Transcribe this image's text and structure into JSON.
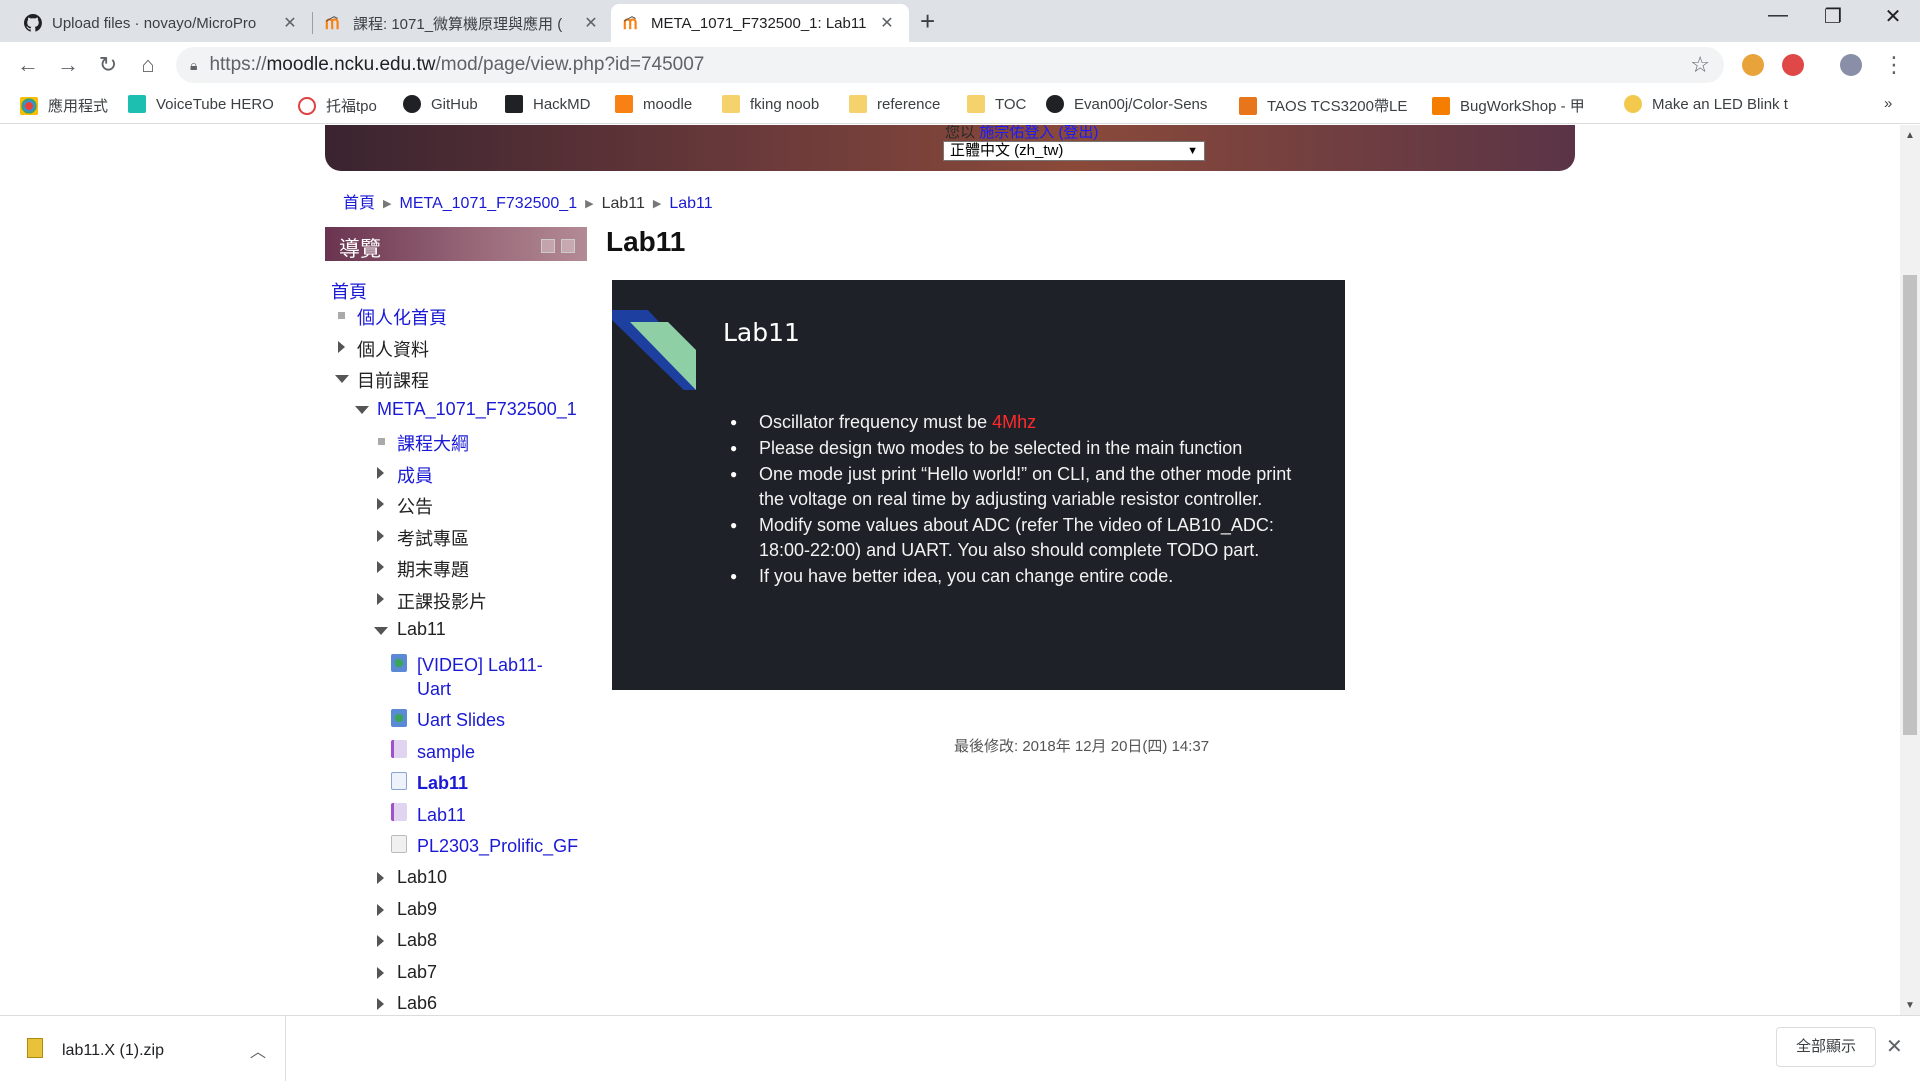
{
  "browser": {
    "tabs": [
      {
        "title": "Upload files · novayo/MicroPro",
        "icon": "github-icon"
      },
      {
        "title": "課程: 1071_微算機原理與應用 (",
        "icon": "moodle-icon"
      },
      {
        "title": "META_1071_F732500_1: Lab11",
        "icon": "moodle-icon"
      }
    ],
    "new_tab": "+",
    "controls": {
      "minimize": "—",
      "restore": "❐",
      "close": "✕"
    },
    "url_prefix": "https://",
    "url_host": "moodle.ncku.edu.tw",
    "url_path": "/mod/page/view.php?id=745007",
    "bookmarks": [
      {
        "label": "應用程式",
        "icon": "apps-grid-icon"
      },
      {
        "label": "VoiceTube HERO",
        "icon": "voicetube-icon"
      },
      {
        "label": "托福tpo",
        "icon": "tpo-icon"
      },
      {
        "label": "GitHub",
        "icon": "github-icon"
      },
      {
        "label": "HackMD",
        "icon": "hackmd-icon"
      },
      {
        "label": "moodle",
        "icon": "moodle-icon"
      },
      {
        "label": "fking noob",
        "icon": "folder-icon"
      },
      {
        "label": "reference",
        "icon": "folder-icon"
      },
      {
        "label": "TOC",
        "icon": "folder-icon"
      },
      {
        "label": "Evan00j/Color-Sens",
        "icon": "github-icon"
      },
      {
        "label": "TAOS TCS3200帶LE",
        "icon": "taos-icon"
      },
      {
        "label": "BugWorkShop - 甲",
        "icon": "blogger-icon"
      },
      {
        "label": "Make an LED Blink t",
        "icon": "led-icon"
      }
    ],
    "bookmarks_more": "»"
  },
  "page": {
    "header": {
      "login_prefix": "您以",
      "login_link": "施宗佑登入 (登出)",
      "language": "正體中文 (zh_tw)"
    },
    "breadcrumb": [
      "首頁",
      "META_1071_F732500_1",
      "Lab11",
      "Lab11"
    ],
    "nav_block": {
      "title": "導覽",
      "items": [
        {
          "label": "首頁"
        },
        {
          "label": "個人化首頁"
        },
        {
          "label": "個人資料"
        },
        {
          "label": "目前課程"
        },
        {
          "label": "META_1071_F732500_1"
        },
        {
          "label": "課程大綱"
        },
        {
          "label": "成員"
        },
        {
          "label": "公告"
        },
        {
          "label": "考試專區"
        },
        {
          "label": "期末專題"
        },
        {
          "label": "正課投影片"
        },
        {
          "label": "Lab11"
        },
        {
          "label": "[VIDEO] Lab11-"
        },
        {
          "label": "Uart"
        },
        {
          "label": "Uart Slides"
        },
        {
          "label": "sample"
        },
        {
          "label": "Lab11"
        },
        {
          "label": "Lab11"
        },
        {
          "label": "PL2303_Prolific_GF"
        },
        {
          "label": "Lab10"
        },
        {
          "label": "Lab9"
        },
        {
          "label": "Lab8"
        },
        {
          "label": "Lab7"
        },
        {
          "label": "Lab6"
        }
      ]
    },
    "main_title": "Lab11",
    "slide": {
      "title": "Lab11",
      "bullets": {
        "b1_pre": "Oscillator frequency must be ",
        "b1_red": "4Mhz",
        "b2": "Please design two modes to be selected in the main function",
        "b3": "One mode just print “Hello world!” on CLI, and the other mode print the voltage on real time by adjusting variable resistor controller.",
        "b4": "Modify some values about ADC (refer The video of LAB10_ADC: 18:00-22:00) and UART. You also should complete TODO part.",
        "b5": "If you have better idea, you can change entire code."
      },
      "accent_colors": {
        "blue": "#1c3fa0",
        "green": "#8ecfa6",
        "red": "#ff2b2b"
      }
    },
    "last_modified": "最後修改: 2018年 12月 20日(四) 14:37"
  },
  "downloads": {
    "file_name": "lab11.X (1).zip",
    "show_all": "全部顯示"
  }
}
